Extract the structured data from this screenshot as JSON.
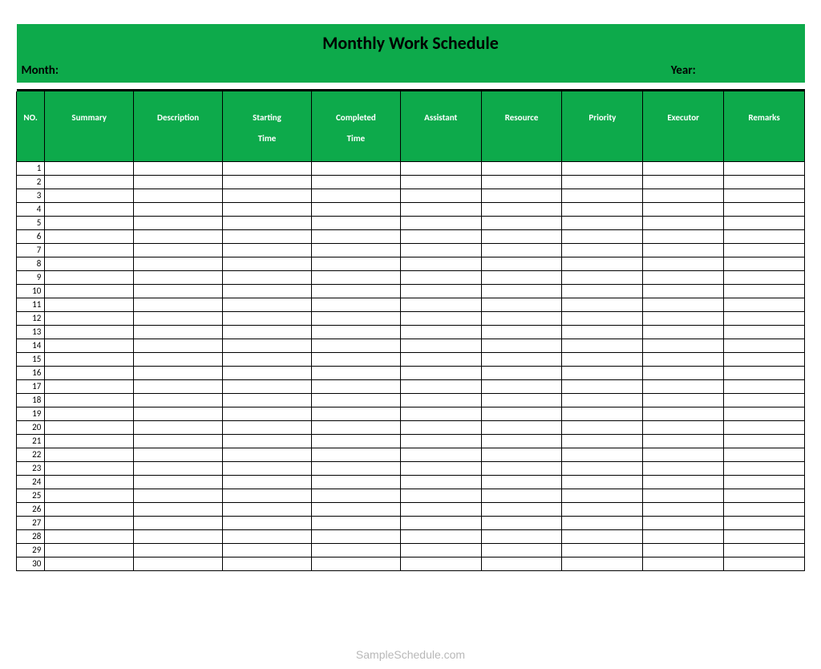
{
  "title": "Monthly Work Schedule",
  "labels": {
    "month": "Month:",
    "year": "Year:"
  },
  "columns": {
    "no": "NO.",
    "summary": "Summary",
    "description": "Description",
    "starting_time": "Starting\nTime",
    "completed_time": "Completed\nTime",
    "assistant": "Assistant",
    "resource": "Resource",
    "priority": "Priority",
    "executor": "Executor",
    "remarks": "Remarks"
  },
  "rows": [
    {
      "no": "1"
    },
    {
      "no": "2"
    },
    {
      "no": "3"
    },
    {
      "no": "4"
    },
    {
      "no": "5"
    },
    {
      "no": "6"
    },
    {
      "no": "7"
    },
    {
      "no": "8"
    },
    {
      "no": "9"
    },
    {
      "no": "10"
    },
    {
      "no": "11"
    },
    {
      "no": "12"
    },
    {
      "no": "13"
    },
    {
      "no": "14"
    },
    {
      "no": "15"
    },
    {
      "no": "16"
    },
    {
      "no": "17"
    },
    {
      "no": "18"
    },
    {
      "no": "19"
    },
    {
      "no": "20"
    },
    {
      "no": "21"
    },
    {
      "no": "22"
    },
    {
      "no": "23"
    },
    {
      "no": "24"
    },
    {
      "no": "25"
    },
    {
      "no": "26"
    },
    {
      "no": "27"
    },
    {
      "no": "28"
    },
    {
      "no": "29"
    },
    {
      "no": "30"
    }
  ],
  "watermark": "SampleSchedule.com",
  "colors": {
    "green": "#0daa4b",
    "black": "#000000",
    "white": "#ffffff"
  }
}
